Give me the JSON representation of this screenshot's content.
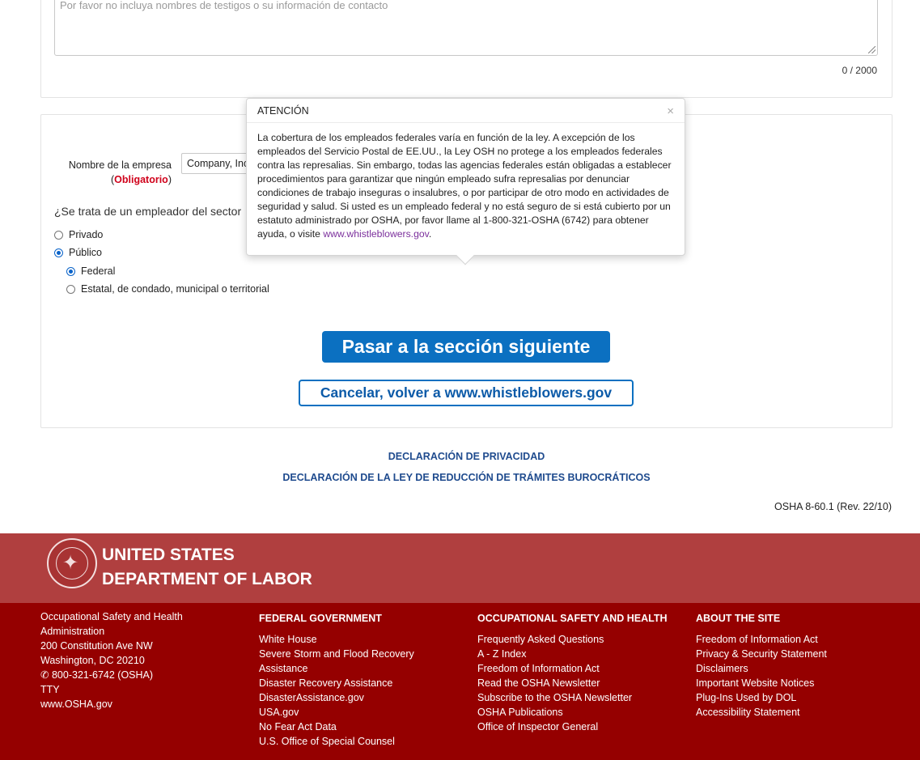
{
  "witness_field": {
    "placeholder": "Por favor no incluya nombres de testigos o su información de contacto",
    "counter": "0 / 2000"
  },
  "employer": {
    "company_label": "Nombre de la empresa",
    "required_open": "(",
    "required_text": "Obligatorio",
    "required_close": ")",
    "company_value": "Company, Inc",
    "sector_question": "¿Se trata de un empleador del sector",
    "options": {
      "private": "Privado",
      "public": "Público",
      "federal": "Federal",
      "state": "Estatal, de condado, municipal o territorial"
    },
    "selected": {
      "public": true,
      "federal": true
    }
  },
  "popover": {
    "title": "ATENCIÓN",
    "close": "×",
    "body": "La cobertura de los empleados federales varía en función de la ley. A excepción de los empleados del Servicio Postal de EE.UU., la Ley OSH no protege a los empleados federales contra las represalias. Sin embargo, todas las agencias federales están obligadas a establecer procedimientos para garantizar que ningún empleado sufra represalias por denunciar condiciones de trabajo inseguras o insalubres, o por participar de otro modo en actividades de seguridad y salud. Si usted es un empleado federal y no está seguro de si está cubierto por un estatuto administrado por OSHA, por favor llame al 1-800-321-OSHA (6742) para obtener ayuda, o visite",
    "link": "www.whistleblowers.gov",
    "after_link": "."
  },
  "buttons": {
    "next": "Pasar a la sección siguiente",
    "cancel": "Cancelar, volver a www.whistleblowers.gov"
  },
  "links": {
    "privacy": "DECLARACIÓN DE PRIVACIDAD",
    "paperwork": "DECLARACIÓN DE LA LEY DE REDUCCIÓN DE TRÁMITES BUROCRÁTICOS"
  },
  "form_id": "OSHA 8-60.1 (Rev. 22/10)",
  "dol": {
    "line1": "UNITED STATES",
    "line2": "DEPARTMENT OF LABOR",
    "seal_icon": "dol-seal-icon"
  },
  "footer": {
    "address": {
      "line1": "Occupational Safety and Health",
      "line2": "Administration",
      "line3": "200 Constitution Ave NW",
      "line4": "Washington, DC 20210",
      "phone": "800-321-6742 (OSHA)",
      "tty": "TTY",
      "site": "www.OSHA.gov"
    },
    "federal_government": {
      "title": "FEDERAL GOVERNMENT",
      "items": [
        "White House",
        "Severe Storm and Flood Recovery",
        "Assistance",
        "Disaster Recovery Assistance",
        "DisasterAssistance.gov",
        "USA.gov",
        "No Fear Act Data",
        "U.S. Office of Special Counsel"
      ]
    },
    "osha": {
      "title": "OCCUPATIONAL SAFETY AND HEALTH",
      "items": [
        "Frequently Asked Questions",
        "A - Z Index",
        "Freedom of Information Act",
        "Read the OSHA Newsletter",
        "Subscribe to the OSHA Newsletter",
        "OSHA Publications",
        "Office of Inspector General"
      ]
    },
    "about": {
      "title": "ABOUT THE SITE",
      "items": [
        "Freedom of Information Act",
        "Privacy & Security Statement",
        "Disclaimers",
        "Important Website Notices",
        "Plug-Ins Used by DOL",
        "Accessibility Statement"
      ]
    }
  },
  "colors": {
    "primary": "#0b70c1",
    "required": "#d0021b",
    "footer_band": "#b03f3f",
    "footer": "#950000",
    "link_dark": "#1f4b8e"
  }
}
